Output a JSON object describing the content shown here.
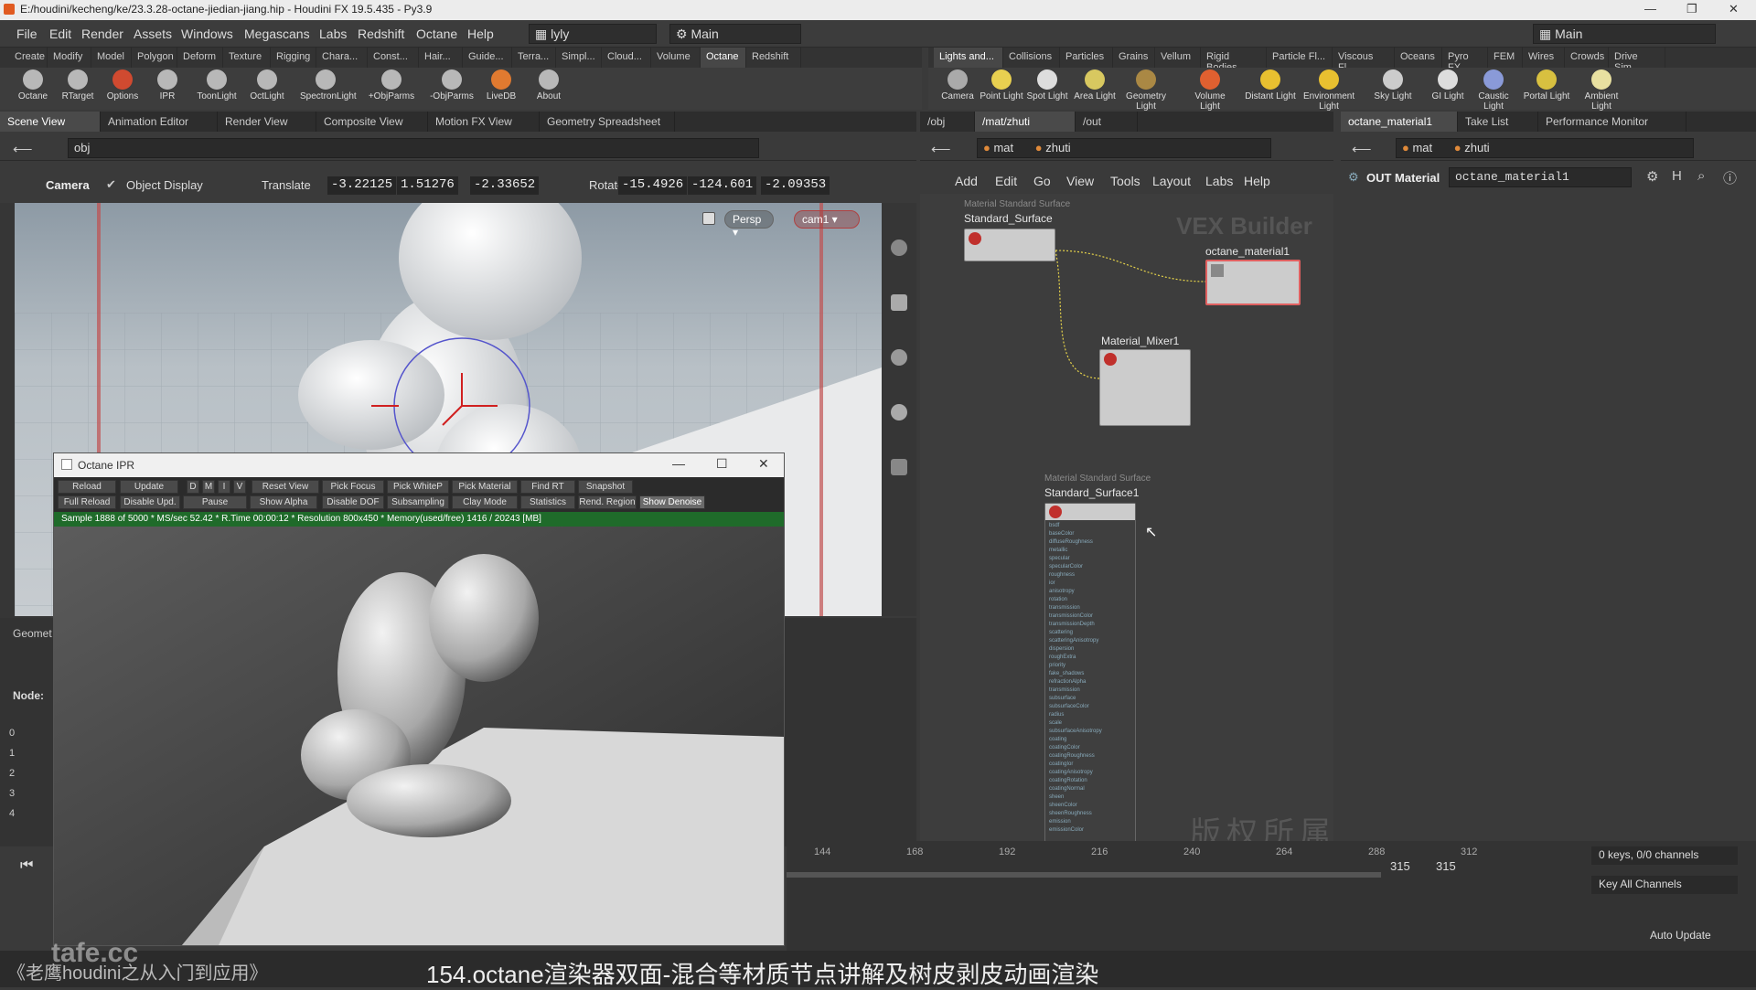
{
  "title": "E:/houdini/kecheng/ke/23.3.28-octane-jiedian-jiang.hip - Houdini FX 19.5.435 - Py3.9",
  "menu": [
    "File",
    "Edit",
    "Render",
    "Assets",
    "Windows",
    "Megascans",
    "Labs",
    "Redshift",
    "Octane",
    "Render",
    "Help"
  ],
  "desktop1": "lyly",
  "desktop2": "Main",
  "desktop3": "Main",
  "shelf_tabs": [
    "Create",
    "Modify",
    "Model",
    "Polygon",
    "Deform",
    "Texture",
    "Rigging",
    "Chara...",
    "Const...",
    "Hair...",
    "Guide...",
    "Terra...",
    "Simpl...",
    "Cloud...",
    "Volume",
    "Octane",
    "Redshift"
  ],
  "shelf_tabs2": [
    "Lights and...",
    "Collisions",
    "Particles",
    "Grains",
    "Vellum",
    "Rigid Bodies",
    "Particle Fl...",
    "Viscous Fl...",
    "Oceans",
    "Pyro FX",
    "FEM",
    "Wires",
    "Crowds",
    "Drive Sim..."
  ],
  "shelf_tools": [
    "Octane",
    "RTarget",
    "Options",
    "IPR",
    "ToonLight",
    "OctLight",
    "SpectronLight",
    "+ObjParms",
    "-ObjParms",
    "LiveDB",
    "About"
  ],
  "shelf_tools2": [
    "Camera",
    "Point Light",
    "Spot Light",
    "Area Light",
    "Geometry Light",
    "Volume Light",
    "Distant Light",
    "Environment Light",
    "Sky Light",
    "GI Light",
    "Caustic Light",
    "Portal Light",
    "Ambient Light"
  ],
  "pane_tabs_left": [
    "Scene View",
    "Animation Editor",
    "Render View",
    "Composite View",
    "Motion FX View",
    "Geometry Spreadsheet"
  ],
  "pane_tabs_mid": [
    "/obj",
    "/mat/zhuti",
    "/out"
  ],
  "pane_tabs_right": [
    "octane_material1",
    "Take List",
    "Performance Monitor"
  ],
  "path_left": "obj",
  "path_mid": [
    "mat",
    "zhuti"
  ],
  "path_right": [
    "mat",
    "zhuti"
  ],
  "viewer": {
    "camera": "Camera",
    "object_display": "Object Display",
    "translate_label": "Translate",
    "translate": [
      "-3.22125",
      "1.51276",
      "-2.33652"
    ],
    "rotate_label": "Rotate",
    "rotate": [
      "-15.4926",
      "-124.601",
      "-2.09353"
    ],
    "persp": "Persp",
    "cam": "cam1"
  },
  "net_menu": [
    "Add",
    "Edit",
    "Go",
    "View",
    "Tools",
    "Layout",
    "Labs",
    "Help"
  ],
  "vex_builder": "VEX Builder",
  "nodes": {
    "n1_type": "Material Standard Surface",
    "n1_name": "Standard_Surface",
    "n2_name": "octane_material1",
    "n3_name": "Material_Mixer1",
    "n4_type": "Material Standard Surface",
    "n4_name": "Standard_Surface1"
  },
  "n4_ports": [
    "bsdf",
    "baseColor",
    "diffuseRoughness",
    "metallic",
    "specular",
    "specularColor",
    "roughness",
    "ior",
    "anisotropy",
    "rotation",
    "transmission",
    "transmissionColor",
    "transmissionDepth",
    "scattering",
    "scatteringAnisotropy",
    "dispersion",
    "roughExtra",
    "priority",
    "fake_shadows",
    "refractionAlpha",
    "transmission",
    "subsurface",
    "subsurfaceColor",
    "radius",
    "scale",
    "subsurfaceAnisotropy",
    "coating",
    "coatingColor",
    "coatingRoughness",
    "coatingIor",
    "coatingAnisotropy",
    "coatingRotation",
    "coatingNormal",
    "sheen",
    "sheenColor",
    "sheenRoughness",
    "emission",
    "emissionColor"
  ],
  "param": {
    "label": "OUT Material",
    "value": "octane_material1"
  },
  "ipr": {
    "title": "Octane IPR",
    "row1": [
      "Reload",
      "Update",
      "D",
      "M",
      "I",
      "V",
      "Reset View",
      "Pick Focus",
      "Pick WhiteP",
      "Pick Material",
      "Find RT",
      "Snapshot"
    ],
    "row2": [
      "Full Reload",
      "Disable Upd.",
      "Pause",
      "Show Alpha",
      "Disable DOF",
      "Subsampling",
      "Clay Mode",
      "Statistics",
      "Rend. Region",
      "Show Denoise"
    ],
    "status": "Sample 1888 of 5000 * MS/sec 52.42 * R.Time 00:00:12 * Resolution 800x450 * Memory(used/free) 1416 / 20243 [MB]"
  },
  "spreadsheet": {
    "node_label": "Node:",
    "rows": [
      "0",
      "1",
      "2",
      "3",
      "4"
    ],
    "geo_label": "Geomet"
  },
  "timeline": {
    "ticks": [
      "144",
      "168",
      "192",
      "216",
      "240",
      "264",
      "288",
      "312"
    ],
    "frame_a": "315",
    "frame_b": "315",
    "keys": "0 keys, 0/0 channels",
    "key_all": "Key All Channels",
    "auto_update": "Auto Update"
  },
  "watermark": "版权所属：老鹰原创教程",
  "subtitle_left": "《老鹰houdini之从入门到应用》",
  "subtitle_main": "154.octane渲染器双面-混合等材质节点讲解及树皮剥皮动画渲染",
  "site": "tafe.cc",
  "colors": {
    "accent_green": "#1f6b2a",
    "node_red": "#c0302c",
    "wire": "#e6d34a"
  }
}
